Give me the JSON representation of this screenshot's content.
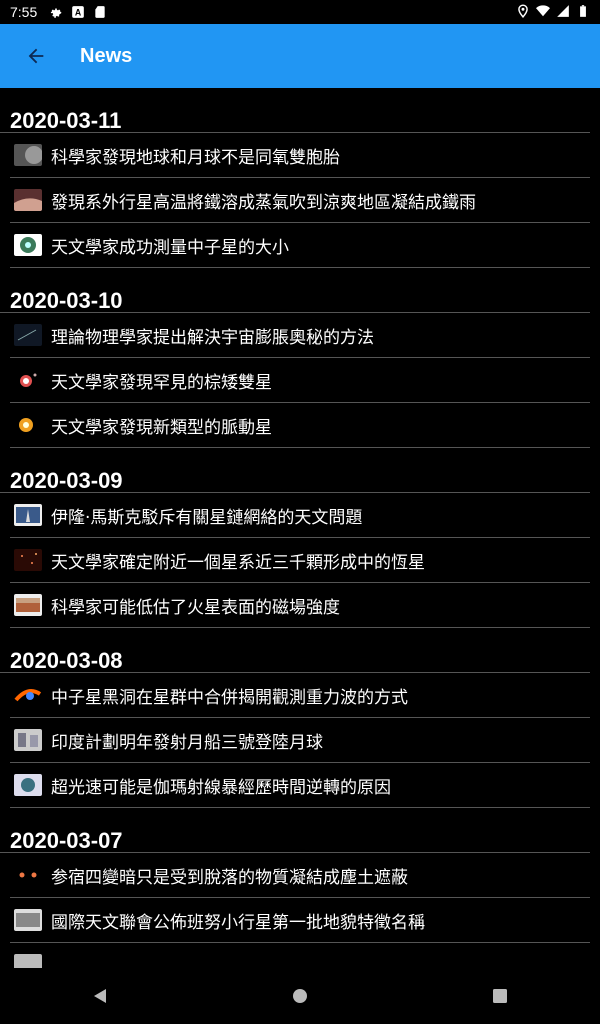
{
  "status_bar": {
    "time": "7:55",
    "left_icons": [
      "settings-icon",
      "a-icon",
      "sd-card-icon"
    ],
    "right_icons": [
      "location-icon",
      "wifi-icon",
      "signal-icon",
      "battery-icon"
    ]
  },
  "app_bar": {
    "title": "News",
    "back_icon": "arrow-back-icon",
    "color": "#2196F3"
  },
  "sections": [
    {
      "date": "2020-03-11",
      "items": [
        {
          "title": "科學家發現地球和月球不是同氧雙胞胎",
          "thumb_color": "#6b6b6b"
        },
        {
          "title": "發現系外行星高温將鐵溶成蒸氣吹到涼爽地區凝結成鐵雨",
          "thumb_color": "#a0665a"
        },
        {
          "title": "天文學家成功測量中子星的大小",
          "thumb_color": "#4a8a6a"
        }
      ]
    },
    {
      "date": "2020-03-10",
      "items": [
        {
          "title": "理論物理學家提出解決宇宙膨脹奧秘的方法",
          "thumb_color": "#1a2a3a"
        },
        {
          "title": "天文學家發現罕見的棕矮雙星",
          "thumb_color": "#b04040"
        },
        {
          "title": "天文學家發現新類型的脈動星",
          "thumb_color": "#e08a10"
        }
      ]
    },
    {
      "date": "2020-03-09",
      "items": [
        {
          "title": "伊隆·馬斯克駁斥有關星鏈網絡的天文問題",
          "thumb_color": "#4a6a9a"
        },
        {
          "title": "天文學家確定附近一個星系近三千顆形成中的恆星",
          "thumb_color": "#5a2010"
        },
        {
          "title": "科學家可能低估了火星表面的磁場強度",
          "thumb_color": "#b06a40"
        }
      ]
    },
    {
      "date": "2020-03-08",
      "items": [
        {
          "title": "中子星黑洞在星群中合併揭開觀測重力波的方式",
          "thumb_color": "#d04020"
        },
        {
          "title": "印度計劃明年發射月船三號登陸月球",
          "thumb_color": "#8a8a9a"
        },
        {
          "title": "超光速可能是伽瑪射線暴經歷時間逆轉的原因",
          "thumb_color": "#4a7a8a"
        }
      ]
    },
    {
      "date": "2020-03-07",
      "items": [
        {
          "title": "参宿四變暗只是受到脫落的物質凝結成塵土遮蔽",
          "thumb_color": "#2a1a1a"
        },
        {
          "title": "國際天文聯會公佈班努小行星第一批地貌特徵名稱",
          "thumb_color": "#7a7a7a"
        }
      ]
    }
  ],
  "nav_bar": {
    "icons": [
      "back-triangle-icon",
      "home-circle-icon",
      "recents-square-icon"
    ]
  }
}
